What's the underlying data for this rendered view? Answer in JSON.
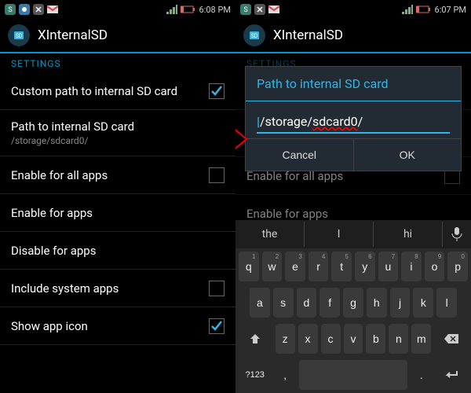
{
  "status": {
    "time_left": "6:08 PM",
    "time_right": "6:07 PM"
  },
  "app": {
    "title": "XInternalSD"
  },
  "settings": {
    "section": "SETTINGS",
    "items": [
      {
        "title": "Custom path to internal SD card",
        "checked": true
      },
      {
        "title": "Path to internal SD card",
        "sub": "/storage/sdcard0/"
      },
      {
        "title": "Enable for all apps",
        "checked": false
      },
      {
        "title": "Enable for apps"
      },
      {
        "title": "Disable for apps"
      },
      {
        "title": "Include system apps",
        "checked": false
      },
      {
        "title": "Show app icon",
        "checked": true
      }
    ]
  },
  "dialog": {
    "title": "Path to internal SD card",
    "value_prefix": "/storage/",
    "value_err": "sdcard0",
    "value_suffix": "/",
    "cancel": "Cancel",
    "ok": "OK"
  },
  "keyboard": {
    "suggestions": [
      "the",
      "I",
      "hi"
    ],
    "row1": [
      "q",
      "w",
      "e",
      "r",
      "t",
      "y",
      "u",
      "i",
      "o",
      "p"
    ],
    "row1_sup": [
      "1",
      "2",
      "3",
      "4",
      "5",
      "6",
      "7",
      "8",
      "9",
      "0"
    ],
    "row2": [
      "a",
      "s",
      "d",
      "f",
      "g",
      "h",
      "j",
      "k",
      "l"
    ],
    "row3": [
      "z",
      "x",
      "c",
      "v",
      "b",
      "n",
      "m"
    ],
    "sym": "?123",
    "space": "",
    "period": ".",
    "comma": ","
  }
}
